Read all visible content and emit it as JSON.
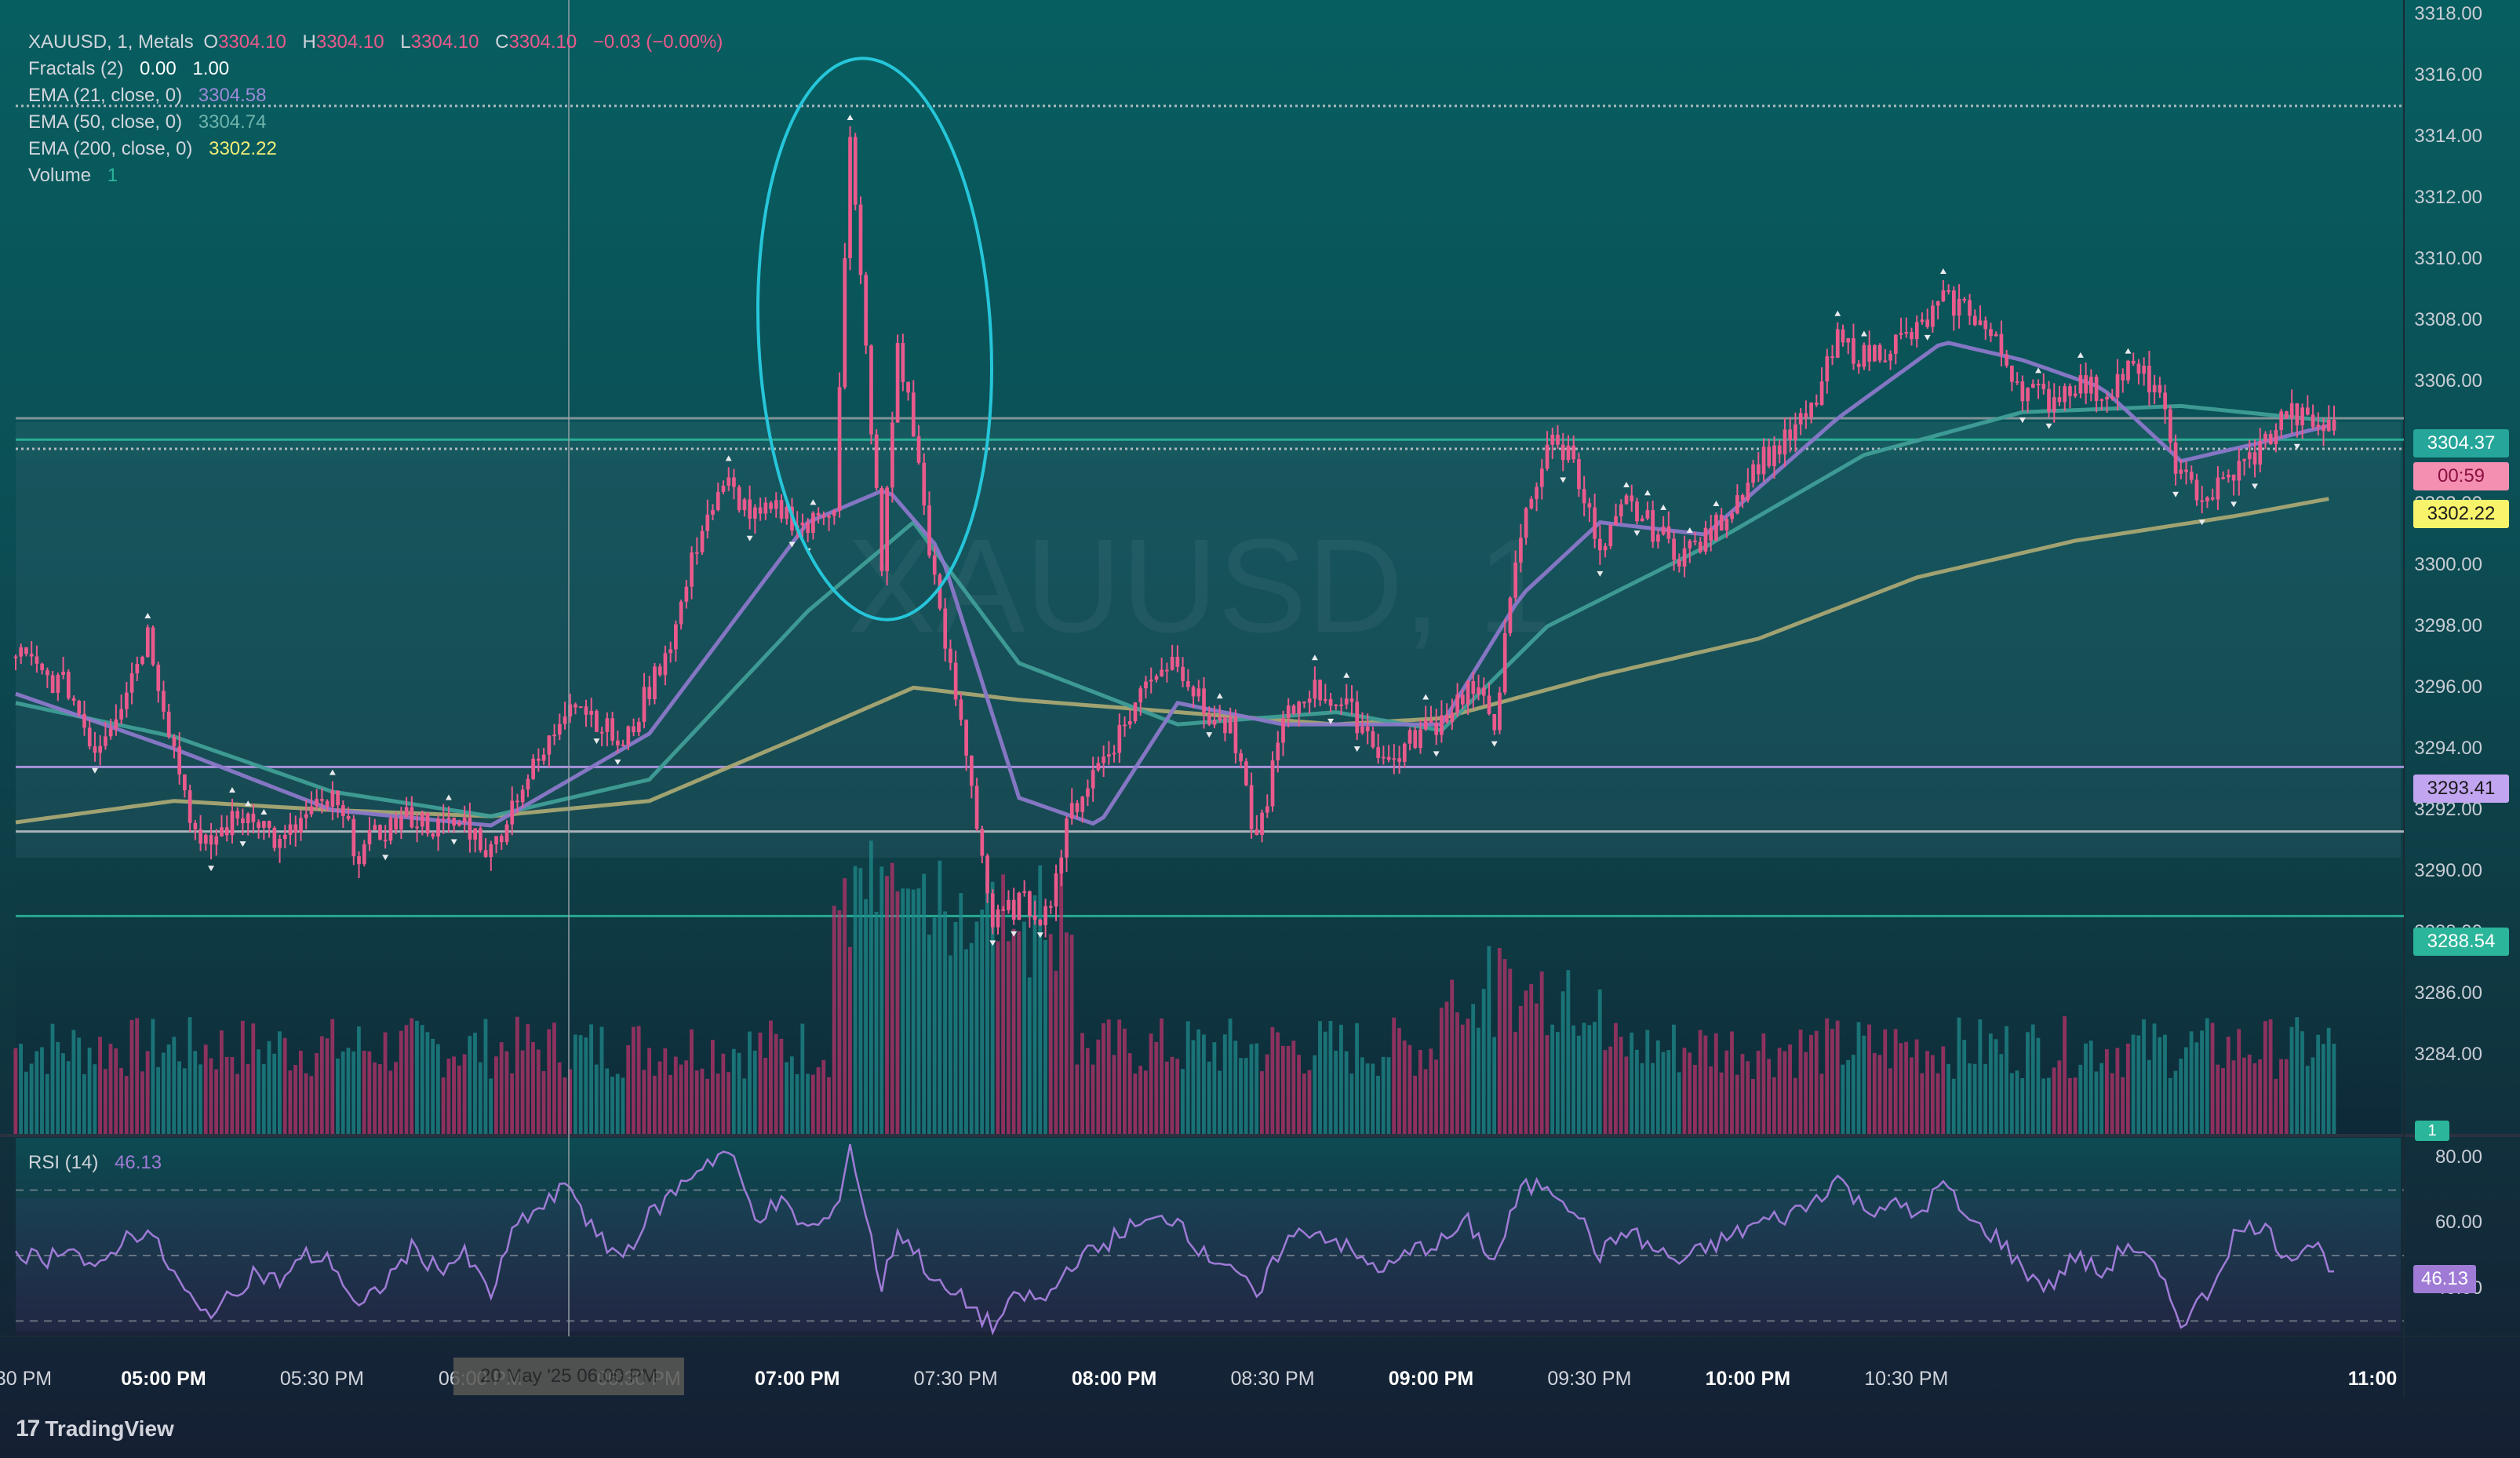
{
  "header": {
    "symbol": "XAUUSD, 1, Metals",
    "o_label": "O",
    "o_value": "3304.10",
    "h_label": "H",
    "h_value": "3304.10",
    "l_label": "L",
    "l_value": "3304.10",
    "c_label": "C",
    "c_value": "3304.10",
    "change": "−0.03 (−0.00%)"
  },
  "indicators": {
    "fractals": {
      "label": "Fractals (2)",
      "v1": "0.00",
      "v2": "1.00"
    },
    "ema21": {
      "label": "EMA (21, close, 0)",
      "value": "3304.58"
    },
    "ema50": {
      "label": "EMA (50, close, 0)",
      "value": "3304.74"
    },
    "ema200": {
      "label": "EMA (200, close, 0)",
      "value": "3302.22"
    },
    "volume": {
      "label": "Volume",
      "value": "1"
    },
    "rsi": {
      "label": "RSI (14)",
      "value": "46.13"
    }
  },
  "watermark": "XAUUSD, 1",
  "branding": "TradingView",
  "cursor_time": "20 May '25 06:00 PM",
  "price_tags": {
    "last": "3304.37",
    "countdown": "00:59",
    "ema200": "3302.22",
    "level_purple": "3293.41",
    "level_green": "3288.54",
    "volume_tag": "1",
    "rsi": "46.13"
  },
  "colors": {
    "up": "#b8336a",
    "down": "#1f8a8a",
    "candle": "#ea5a8c",
    "ema21": "#8a78c9",
    "ema50": "#3f9e97",
    "ema200": "#a8a673",
    "rsi": "#9f7bd6",
    "circle": "#26c6da",
    "level_purple": "#b79ae8",
    "level_green": "#2bb59a"
  },
  "chart_data": {
    "type": "candlestick",
    "symbol": "XAUUSD",
    "timeframe": "1",
    "ylim": [
      3282.5,
      3318
    ],
    "y_ticks": [
      "3318.00",
      "3316.00",
      "3314.00",
      "3312.00",
      "3310.00",
      "3308.00",
      "3306.00",
      "3304.00",
      "3302.00",
      "3300.00",
      "3298.00",
      "3296.00",
      "3294.00",
      "3292.00",
      "3290.00",
      "3288.00",
      "3286.00",
      "3284.00"
    ],
    "x_ticks": [
      "30 PM",
      "05:00 PM",
      "05:30 PM",
      "06:00 PM",
      "06:30 PM",
      "07:00 PM",
      "07:30 PM",
      "08:00 PM",
      "08:30 PM",
      "09:00 PM",
      "09:30 PM",
      "10:00 PM",
      "10:30 PM",
      "11:00"
    ],
    "x_ticks_bold": [
      "05:00 PM",
      "07:00 PM",
      "08:00 PM",
      "09:00 PM",
      "10:00 PM",
      "11:00"
    ],
    "close_path_by_minute": [
      [
        0,
        3297.2
      ],
      [
        5,
        3296.4
      ],
      [
        10,
        3296.0
      ],
      [
        15,
        3294.0
      ],
      [
        20,
        3295.6
      ],
      [
        25,
        3297.8
      ],
      [
        30,
        3294.0
      ],
      [
        35,
        3290.6
      ],
      [
        40,
        3291.5
      ],
      [
        45,
        3292.0
      ],
      [
        50,
        3290.8
      ],
      [
        55,
        3291.8
      ],
      [
        60,
        3292.3
      ],
      [
        65,
        3290.6
      ],
      [
        70,
        3291.4
      ],
      [
        75,
        3291.8
      ],
      [
        80,
        3291.4
      ],
      [
        85,
        3291.6
      ],
      [
        90,
        3290.6
      ],
      [
        95,
        3292.6
      ],
      [
        100,
        3293.8
      ],
      [
        105,
        3295.8
      ],
      [
        110,
        3295.0
      ],
      [
        115,
        3294.0
      ],
      [
        120,
        3296.0
      ],
      [
        125,
        3298.0
      ],
      [
        130,
        3301.4
      ],
      [
        135,
        3302.6
      ],
      [
        140,
        3301.5
      ],
      [
        145,
        3301.8
      ],
      [
        150,
        3301.2
      ],
      [
        155,
        3302.1
      ],
      [
        158,
        3313.8
      ],
      [
        161,
        3307.0
      ],
      [
        164,
        3299.8
      ],
      [
        167,
        3307.2
      ],
      [
        170,
        3304.4
      ],
      [
        175,
        3298.2
      ],
      [
        180,
        3294.0
      ],
      [
        185,
        3288.2
      ],
      [
        190,
        3289.0
      ],
      [
        195,
        3288.6
      ],
      [
        200,
        3292.0
      ],
      [
        205,
        3293.5
      ],
      [
        210,
        3294.8
      ],
      [
        215,
        3296.5
      ],
      [
        220,
        3297.0
      ],
      [
        225,
        3295.2
      ],
      [
        230,
        3294.6
      ],
      [
        235,
        3291.0
      ],
      [
        240,
        3294.8
      ],
      [
        245,
        3296.0
      ],
      [
        250,
        3295.6
      ],
      [
        255,
        3294.8
      ],
      [
        260,
        3293.5
      ],
      [
        265,
        3294.4
      ],
      [
        270,
        3295.0
      ],
      [
        275,
        3296.0
      ],
      [
        280,
        3295.0
      ],
      [
        285,
        3301.0
      ],
      [
        290,
        3304.0
      ],
      [
        295,
        3303.6
      ],
      [
        300,
        3300.2
      ],
      [
        305,
        3302.0
      ],
      [
        310,
        3301.2
      ],
      [
        315,
        3300.4
      ],
      [
        320,
        3300.8
      ],
      [
        325,
        3302.0
      ],
      [
        330,
        3303.4
      ],
      [
        335,
        3304.0
      ],
      [
        340,
        3305.0
      ],
      [
        345,
        3307.3
      ],
      [
        350,
        3306.8
      ],
      [
        355,
        3307.2
      ],
      [
        360,
        3307.6
      ],
      [
        365,
        3308.6
      ],
      [
        370,
        3308.4
      ],
      [
        375,
        3307.2
      ],
      [
        380,
        3305.8
      ],
      [
        385,
        3305.4
      ],
      [
        390,
        3306.0
      ],
      [
        395,
        3305.6
      ],
      [
        400,
        3306.4
      ],
      [
        405,
        3305.9
      ],
      [
        410,
        3302.8
      ],
      [
        415,
        3302.2
      ],
      [
        420,
        3303.0
      ],
      [
        425,
        3303.8
      ],
      [
        430,
        3305.0
      ],
      [
        435,
        3304.6
      ],
      [
        439,
        3304.4
      ]
    ],
    "ema200_by_minute": [
      [
        0,
        3291.6
      ],
      [
        30,
        3292.3
      ],
      [
        60,
        3292.0
      ],
      [
        90,
        3291.8
      ],
      [
        120,
        3292.3
      ],
      [
        150,
        3294.5
      ],
      [
        170,
        3296.0
      ],
      [
        190,
        3295.6
      ],
      [
        220,
        3295.2
      ],
      [
        250,
        3294.8
      ],
      [
        270,
        3295.0
      ],
      [
        300,
        3296.4
      ],
      [
        330,
        3297.6
      ],
      [
        360,
        3299.6
      ],
      [
        390,
        3300.8
      ],
      [
        420,
        3301.6
      ],
      [
        439,
        3302.2
      ]
    ],
    "ema50_by_minute": [
      [
        0,
        3295.5
      ],
      [
        30,
        3294.4
      ],
      [
        60,
        3292.6
      ],
      [
        90,
        3291.8
      ],
      [
        120,
        3293.0
      ],
      [
        150,
        3298.5
      ],
      [
        170,
        3301.4
      ],
      [
        190,
        3296.8
      ],
      [
        220,
        3294.8
      ],
      [
        250,
        3295.2
      ],
      [
        270,
        3294.6
      ],
      [
        290,
        3298.0
      ],
      [
        320,
        3300.6
      ],
      [
        350,
        3303.6
      ],
      [
        380,
        3305.0
      ],
      [
        410,
        3305.2
      ],
      [
        439,
        3304.7
      ]
    ],
    "ema21_by_minute": [
      [
        0,
        3295.8
      ],
      [
        30,
        3294.0
      ],
      [
        60,
        3292.0
      ],
      [
        90,
        3291.5
      ],
      [
        120,
        3294.5
      ],
      [
        150,
        3301.4
      ],
      [
        165,
        3302.5
      ],
      [
        175,
        3300.5
      ],
      [
        190,
        3292.4
      ],
      [
        205,
        3291.5
      ],
      [
        220,
        3295.5
      ],
      [
        240,
        3294.8
      ],
      [
        270,
        3294.8
      ],
      [
        285,
        3299.0
      ],
      [
        300,
        3301.4
      ],
      [
        320,
        3301.0
      ],
      [
        345,
        3304.8
      ],
      [
        365,
        3307.3
      ],
      [
        380,
        3306.7
      ],
      [
        395,
        3305.8
      ],
      [
        410,
        3303.4
      ],
      [
        425,
        3304.0
      ],
      [
        439,
        3304.6
      ]
    ],
    "horizontal_levels": [
      {
        "price": 3304.8,
        "color": "#8d9aa0",
        "style": "solid"
      },
      {
        "price": 3304.1,
        "color": "#2bb59a",
        "style": "solid"
      },
      {
        "price": 3303.8,
        "color": "#c0c4cc",
        "style": "dotted"
      },
      {
        "price": 3293.41,
        "color": "#b79ae8",
        "style": "solid"
      },
      {
        "price": 3291.3,
        "color": "#b8bcc4",
        "style": "solid"
      },
      {
        "price": 3288.54,
        "color": "#2bb59a",
        "style": "solid"
      },
      {
        "price": 3315.0,
        "color": "#c0c4cc",
        "style": "dotted"
      }
    ],
    "rsi": {
      "ylim": [
        26,
        86
      ],
      "ticks": [
        "80.00",
        "60.00",
        "40.00"
      ],
      "bands": [
        70,
        50,
        30
      ],
      "values_by_minute": [
        [
          0,
          52
        ],
        [
          5,
          48
        ],
        [
          10,
          54
        ],
        [
          15,
          44
        ],
        [
          20,
          55
        ],
        [
          25,
          58
        ],
        [
          30,
          44
        ],
        [
          35,
          32
        ],
        [
          40,
          36
        ],
        [
          45,
          45
        ],
        [
          50,
          42
        ],
        [
          55,
          50
        ],
        [
          60,
          48
        ],
        [
          65,
          33
        ],
        [
          70,
          42
        ],
        [
          75,
          52
        ],
        [
          80,
          46
        ],
        [
          85,
          50
        ],
        [
          90,
          38
        ],
        [
          95,
          60
        ],
        [
          100,
          65
        ],
        [
          105,
          72
        ],
        [
          110,
          55
        ],
        [
          115,
          50
        ],
        [
          120,
          62
        ],
        [
          125,
          70
        ],
        [
          130,
          78
        ],
        [
          135,
          82
        ],
        [
          140,
          62
        ],
        [
          145,
          66
        ],
        [
          150,
          58
        ],
        [
          155,
          62
        ],
        [
          158,
          84
        ],
        [
          161,
          62
        ],
        [
          164,
          40
        ],
        [
          167,
          58
        ],
        [
          170,
          52
        ],
        [
          175,
          40
        ],
        [
          180,
          36
        ],
        [
          185,
          28
        ],
        [
          190,
          38
        ],
        [
          195,
          36
        ],
        [
          200,
          48
        ],
        [
          205,
          52
        ],
        [
          210,
          58
        ],
        [
          215,
          60
        ],
        [
          220,
          62
        ],
        [
          225,
          50
        ],
        [
          230,
          48
        ],
        [
          235,
          36
        ],
        [
          240,
          54
        ],
        [
          245,
          58
        ],
        [
          250,
          55
        ],
        [
          255,
          48
        ],
        [
          260,
          46
        ],
        [
          265,
          52
        ],
        [
          270,
          54
        ],
        [
          275,
          60
        ],
        [
          280,
          48
        ],
        [
          285,
          70
        ],
        [
          290,
          72
        ],
        [
          295,
          65
        ],
        [
          300,
          50
        ],
        [
          305,
          58
        ],
        [
          310,
          52
        ],
        [
          315,
          48
        ],
        [
          320,
          52
        ],
        [
          325,
          56
        ],
        [
          330,
          60
        ],
        [
          335,
          62
        ],
        [
          340,
          66
        ],
        [
          345,
          74
        ],
        [
          350,
          64
        ],
        [
          355,
          66
        ],
        [
          360,
          62
        ],
        [
          365,
          72
        ],
        [
          370,
          60
        ],
        [
          375,
          56
        ],
        [
          380,
          46
        ],
        [
          385,
          40
        ],
        [
          390,
          50
        ],
        [
          395,
          44
        ],
        [
          400,
          54
        ],
        [
          405,
          46
        ],
        [
          410,
          30
        ],
        [
          415,
          38
        ],
        [
          420,
          56
        ],
        [
          425,
          60
        ],
        [
          430,
          50
        ],
        [
          435,
          54
        ],
        [
          439,
          46
        ]
      ]
    }
  }
}
